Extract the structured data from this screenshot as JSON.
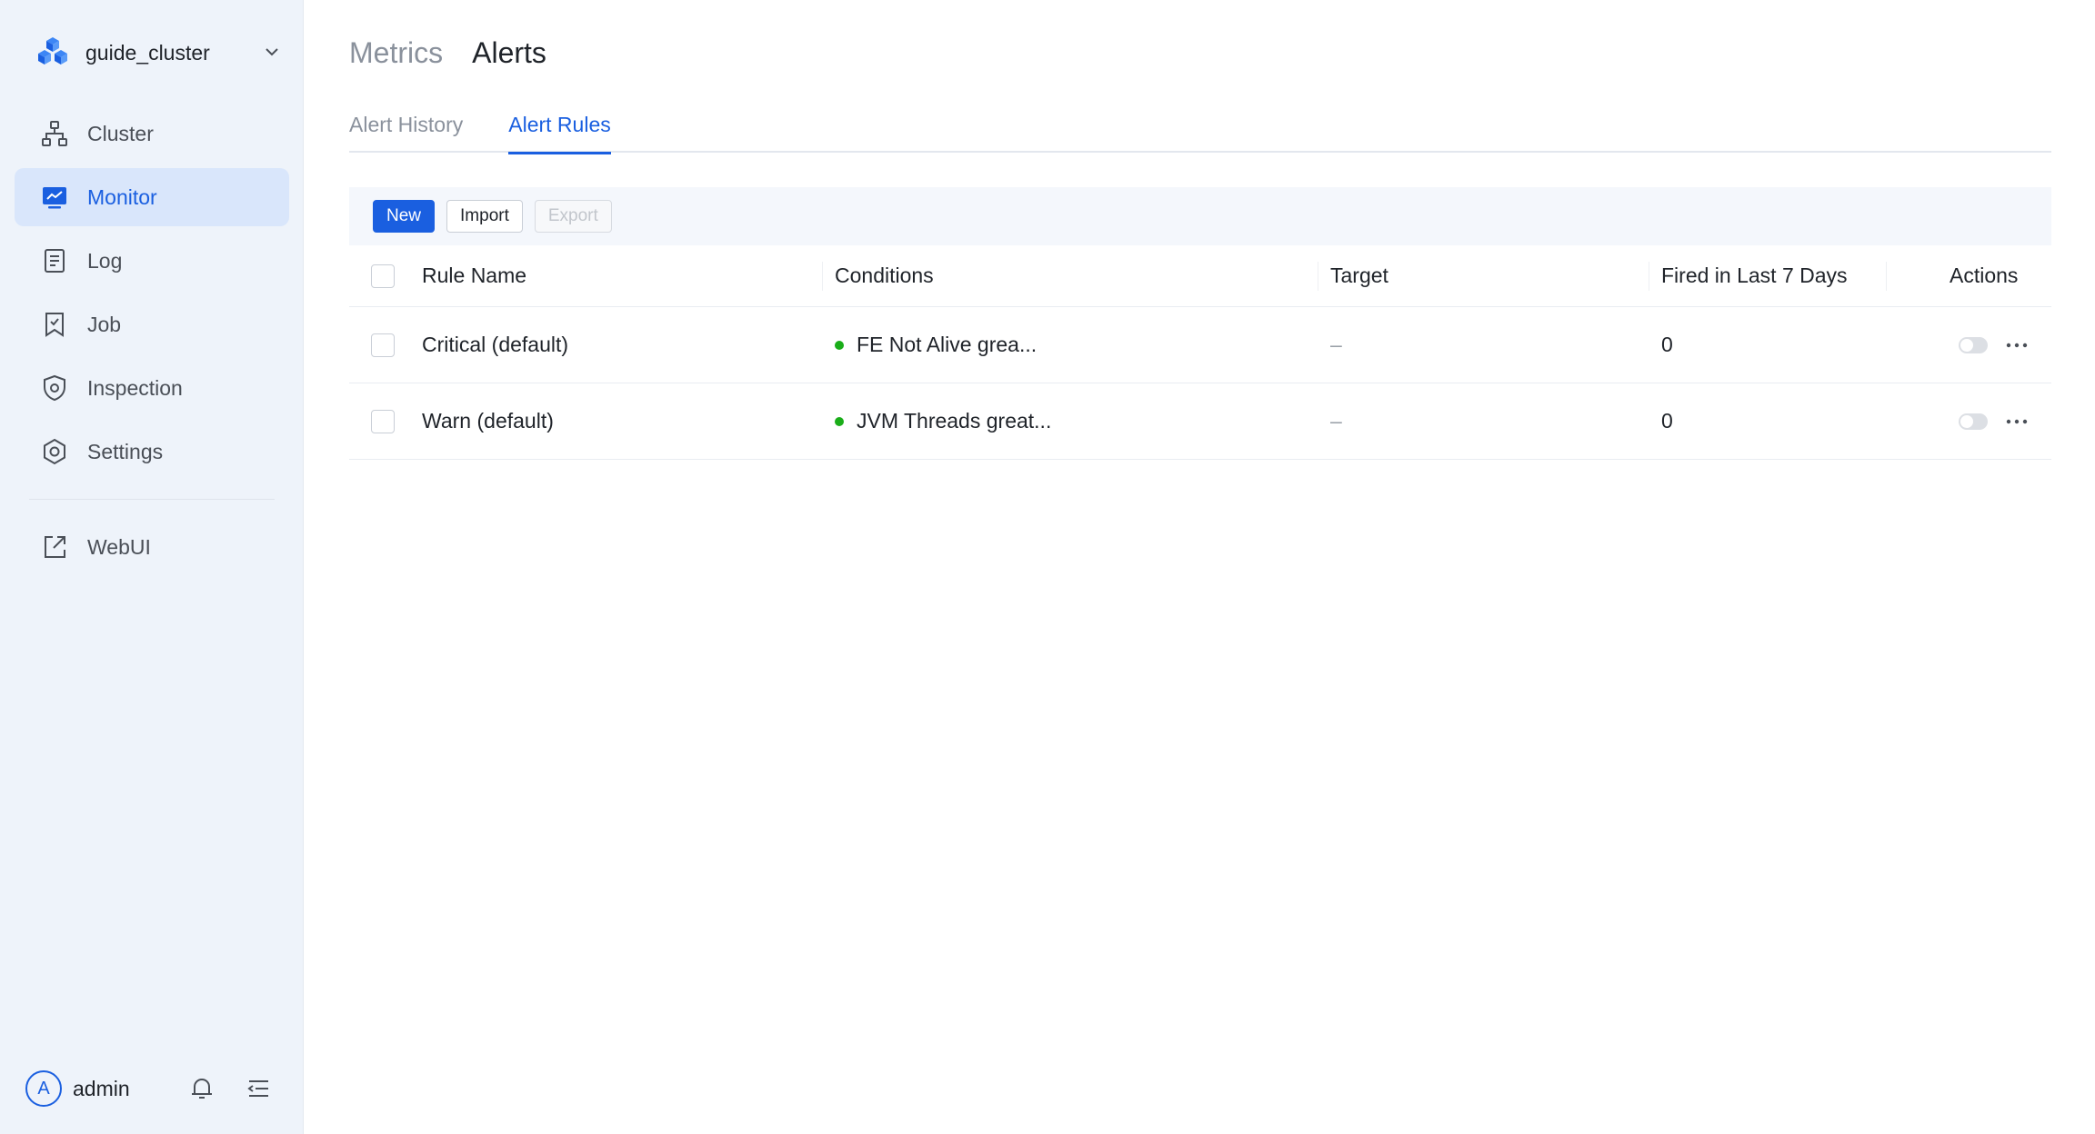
{
  "sidebar": {
    "cluster_name": "guide_cluster",
    "items": [
      {
        "label": "Cluster",
        "icon": "cluster-icon"
      },
      {
        "label": "Monitor",
        "icon": "monitor-icon",
        "active": true
      },
      {
        "label": "Log",
        "icon": "log-icon"
      },
      {
        "label": "Job",
        "icon": "job-icon"
      },
      {
        "label": "Inspection",
        "icon": "inspection-icon"
      },
      {
        "label": "Settings",
        "icon": "settings-icon"
      }
    ],
    "external": {
      "label": "WebUI",
      "icon": "external-link-icon"
    },
    "user": {
      "avatar_letter": "A",
      "name": "admin"
    }
  },
  "breadcrumb": {
    "parent": "Metrics",
    "current": "Alerts"
  },
  "tabs": [
    {
      "label": "Alert History"
    },
    {
      "label": "Alert Rules",
      "active": true
    }
  ],
  "toolbar": {
    "new_label": "New",
    "import_label": "Import",
    "export_label": "Export"
  },
  "table": {
    "headers": {
      "name": "Rule Name",
      "conditions": "Conditions",
      "target": "Target",
      "fired": "Fired in Last 7 Days",
      "actions": "Actions"
    },
    "rows": [
      {
        "name": "Critical (default)",
        "condition": "FE Not Alive grea...",
        "target": "–",
        "fired": "0",
        "enabled": false
      },
      {
        "name": "Warn (default)",
        "condition": "JVM Threads great...",
        "target": "–",
        "fired": "0",
        "enabled": false
      }
    ]
  },
  "colors": {
    "accent": "#1a5fe0",
    "status_dot": "#1aad19",
    "sidebar_bg": "#eef3fa"
  }
}
